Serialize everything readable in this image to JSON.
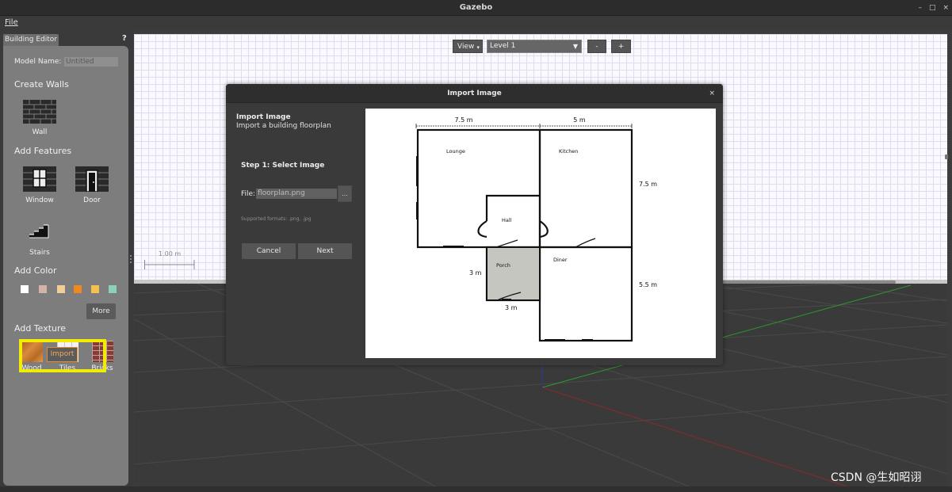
{
  "window": {
    "title": "Gazebo",
    "controls": [
      "–",
      "□",
      "×"
    ]
  },
  "menu": {
    "file": "File"
  },
  "left_panel": {
    "tab": "Building Editor",
    "help": "?",
    "model_name_label": "Model Name:",
    "model_name_value": "Untitled",
    "create_walls": "Create Walls",
    "wall": "Wall",
    "add_features": "Add Features",
    "window": "Window",
    "door": "Door",
    "stairs": "Stairs",
    "add_color": "Add Color",
    "colors": [
      "#ffffff",
      "#d3b3a5",
      "#efcf97",
      "#f0891d",
      "#f6bf52",
      "#8cd1b5"
    ],
    "more": "More",
    "add_texture": "Add Texture",
    "wood": "Wood",
    "tiles": "Tiles",
    "bricks": "Bricks",
    "import": "Import",
    "highlight_color": "#f2ec00"
  },
  "editor": {
    "view_button": "View",
    "level_select": "Level 1",
    "minus": "-",
    "plus": "+",
    "scale_label": "1.00 m"
  },
  "dialog": {
    "title": "Import Image",
    "close": "×",
    "heading": "Import Image",
    "subheading": "Import a building floorplan",
    "step": "Step 1: Select Image",
    "file_label": "File:",
    "file_value": "floorplan.png",
    "browse": "...",
    "formats": "Supported formats: .png, .jpg",
    "cancel": "Cancel",
    "next": "Next"
  },
  "floorplan": {
    "dim_top_left": "7.5 m",
    "dim_top_right": "5 m",
    "dim_right_upper": "7.5 m",
    "dim_right_lower": "5.5 m",
    "dim_porch_side": "3 m",
    "dim_porch_bottom": "3 m",
    "rooms": {
      "lounge": "Lounge",
      "kitchen": "Kitchen",
      "hall": "Hall",
      "porch": "Porch",
      "diner": "Diner"
    }
  },
  "watermark": "CSDN @生如昭诩"
}
